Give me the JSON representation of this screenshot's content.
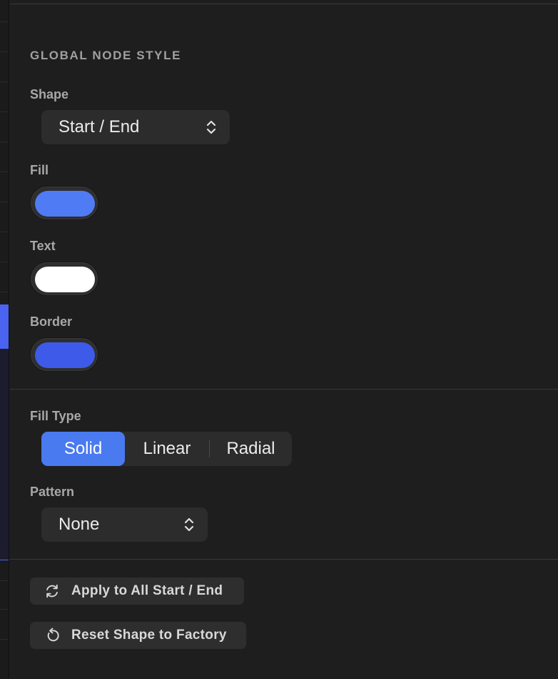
{
  "section_title": "GLOBAL NODE STYLE",
  "shape": {
    "label": "Shape",
    "value": "Start / End",
    "icon": "chevron-up-down-icon"
  },
  "fill": {
    "label": "Fill",
    "color": "#4f7cf5"
  },
  "text": {
    "label": "Text",
    "color": "#ffffff"
  },
  "border": {
    "label": "Border",
    "color": "#3d5be8"
  },
  "fill_type": {
    "label": "Fill Type",
    "options": [
      "Solid",
      "Linear",
      "Radial"
    ],
    "selected": "Solid"
  },
  "pattern": {
    "label": "Pattern",
    "value": "None",
    "icon": "chevron-up-down-icon"
  },
  "actions": {
    "apply_label": "Apply to All Start / End",
    "apply_icon": "refresh-icon",
    "reset_label": "Reset Shape to Factory",
    "reset_icon": "undo-icon"
  },
  "colors": {
    "accent": "#4a7af0",
    "panel_bg": "#1e1e1e",
    "control_bg": "#2c2c2c"
  }
}
